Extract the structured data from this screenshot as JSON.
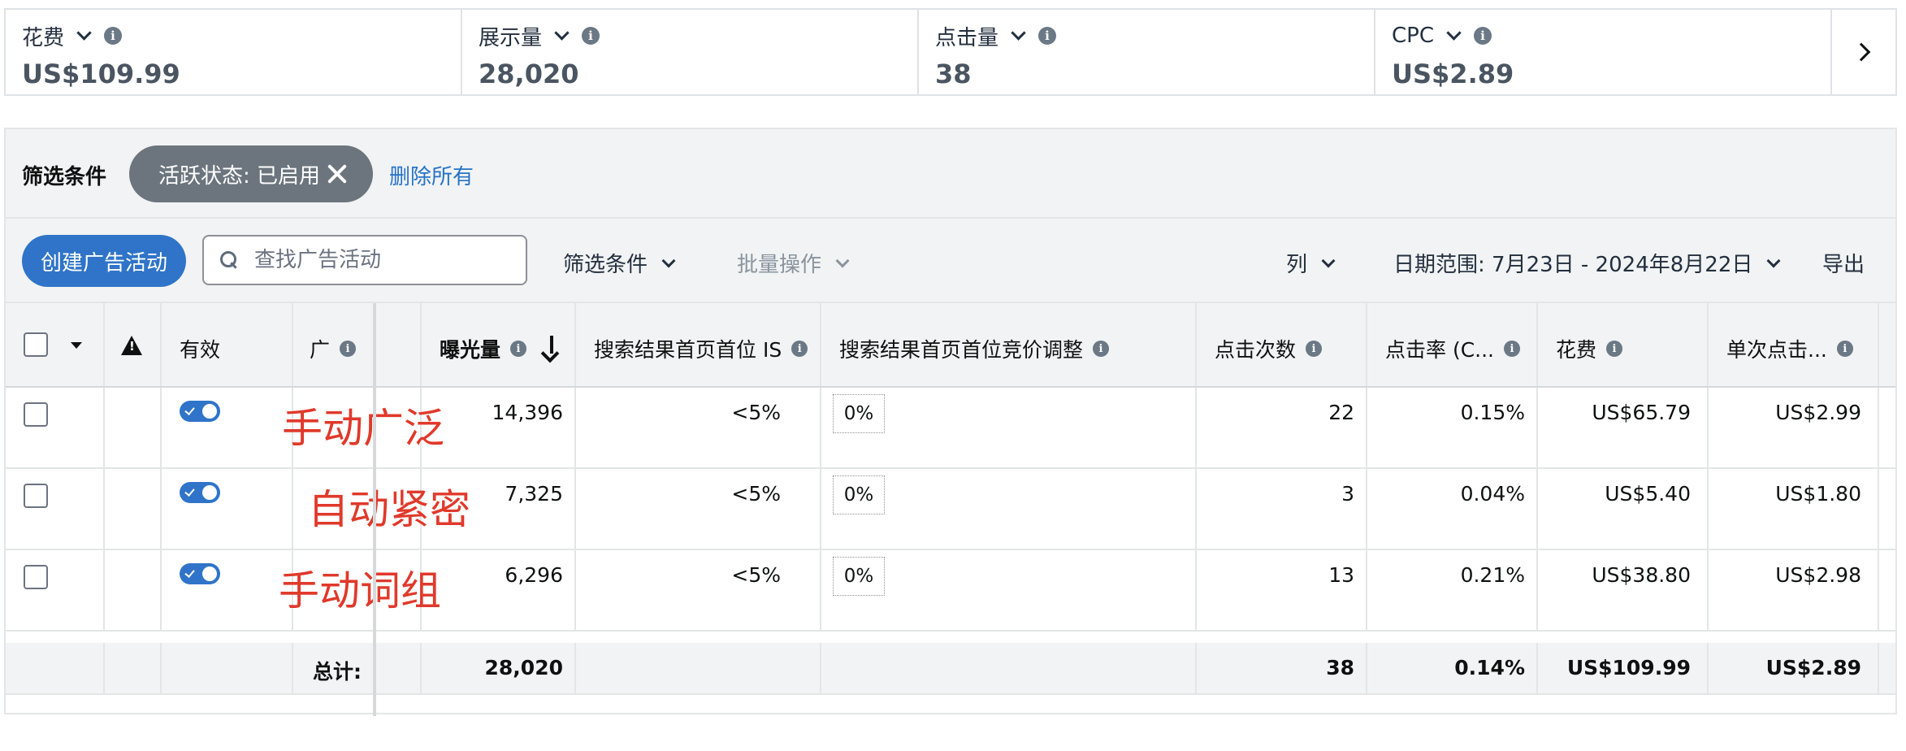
{
  "metrics": [
    {
      "label": "花费",
      "value": "US$109.99"
    },
    {
      "label": "展示量",
      "value": "28,020"
    },
    {
      "label": "点击量",
      "value": "38"
    },
    {
      "label": "CPC",
      "value": "US$2.89"
    }
  ],
  "filters": {
    "title": "筛选条件",
    "chip": "活跃状态: 已启用",
    "clear_all": "删除所有"
  },
  "toolbar": {
    "create": "创建广告活动",
    "search_placeholder": "查找广告活动",
    "filter": "筛选条件",
    "bulk": "批量操作",
    "columns": "列",
    "date_range": "日期范围: 7月23日 - 2024年8月22日",
    "export": "导出"
  },
  "table": {
    "headers": {
      "active": "有效",
      "ad": "广",
      "impressions": "曝光量",
      "top_is": "搜索结果首页首位 IS",
      "top_bid": "搜索结果首页首位竞价调整",
      "clicks": "点击次数",
      "ctr": "点击率 (C...",
      "spend": "花费",
      "cpc": "单次点击..."
    },
    "rows": [
      {
        "overlay": "手动广泛",
        "impressions": "14,396",
        "top_is": "<5%",
        "bid": "0%",
        "clicks": "22",
        "ctr": "0.15%",
        "spend": "US$65.79",
        "cpc": "US$2.99"
      },
      {
        "overlay": "自动紧密",
        "impressions": "7,325",
        "top_is": "<5%",
        "bid": "0%",
        "clicks": "3",
        "ctr": "0.04%",
        "spend": "US$5.40",
        "cpc": "US$1.80"
      },
      {
        "overlay": "手动词组",
        "impressions": "6,296",
        "top_is": "<5%",
        "bid": "0%",
        "clicks": "13",
        "ctr": "0.21%",
        "spend": "US$38.80",
        "cpc": "US$2.98"
      }
    ],
    "total": {
      "label": "总计:",
      "impressions": "28,020",
      "clicks": "38",
      "ctr": "0.14%",
      "spend": "US$109.99",
      "cpc": "US$2.89"
    }
  },
  "colors": {
    "primary": "#2f74c8",
    "link": "#2673c6",
    "chip": "#6c757d",
    "annotation": "#e0392b"
  }
}
